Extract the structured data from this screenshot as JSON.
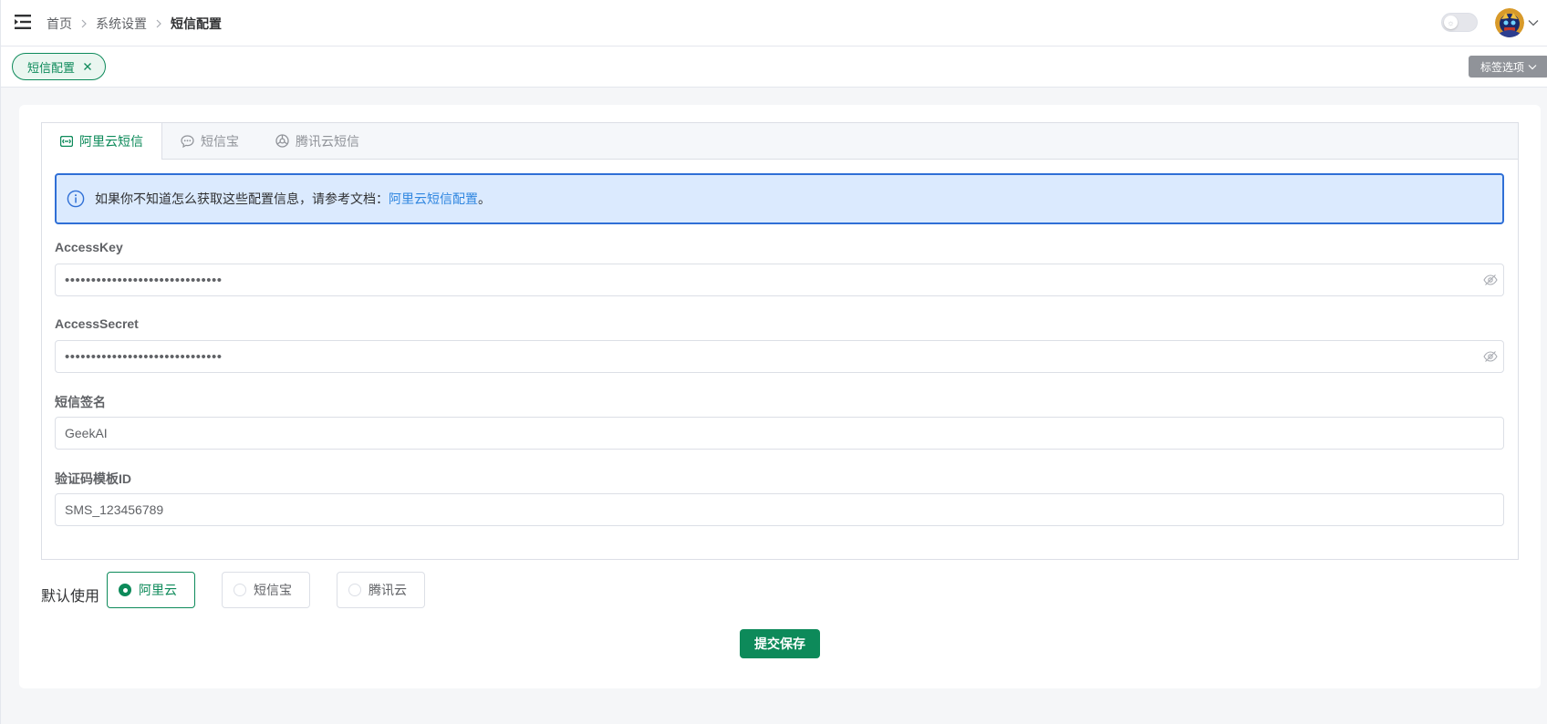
{
  "header": {
    "breadcrumb": [
      "首页",
      "系统设置",
      "短信配置"
    ]
  },
  "tags": {
    "active_tag": "短信配置",
    "options_label": "标签选项"
  },
  "tabs": [
    {
      "label": "阿里云短信",
      "icon": "aliyun-icon",
      "active": true
    },
    {
      "label": "短信宝",
      "icon": "chat-bubble-icon",
      "active": false
    },
    {
      "label": "腾讯云短信",
      "icon": "tencent-cloud-icon",
      "active": false
    }
  ],
  "alert": {
    "text": "如果你不知道怎么获取这些配置信息，请参考文档：",
    "link_text": "阿里云短信配置",
    "suffix": "。"
  },
  "form": {
    "access_key": {
      "label": "AccessKey",
      "value": "••••••••••••••••••••••••••••••"
    },
    "access_secret": {
      "label": "AccessSecret",
      "value": "••••••••••••••••••••••••••••••"
    },
    "sign_name": {
      "label": "短信签名",
      "value": "GeekAI"
    },
    "template_id": {
      "label": "验证码模板ID",
      "value": "SMS_123456789"
    }
  },
  "default_use": {
    "label": "默认使用",
    "options": [
      "阿里云",
      "短信宝",
      "腾讯云"
    ],
    "selected": "阿里云"
  },
  "submit_label": "提交保存",
  "colors": {
    "primary": "#0d8a5a",
    "alert_border": "#2f6fd6",
    "alert_bg": "#dbeafe",
    "link": "#2f86e0"
  }
}
